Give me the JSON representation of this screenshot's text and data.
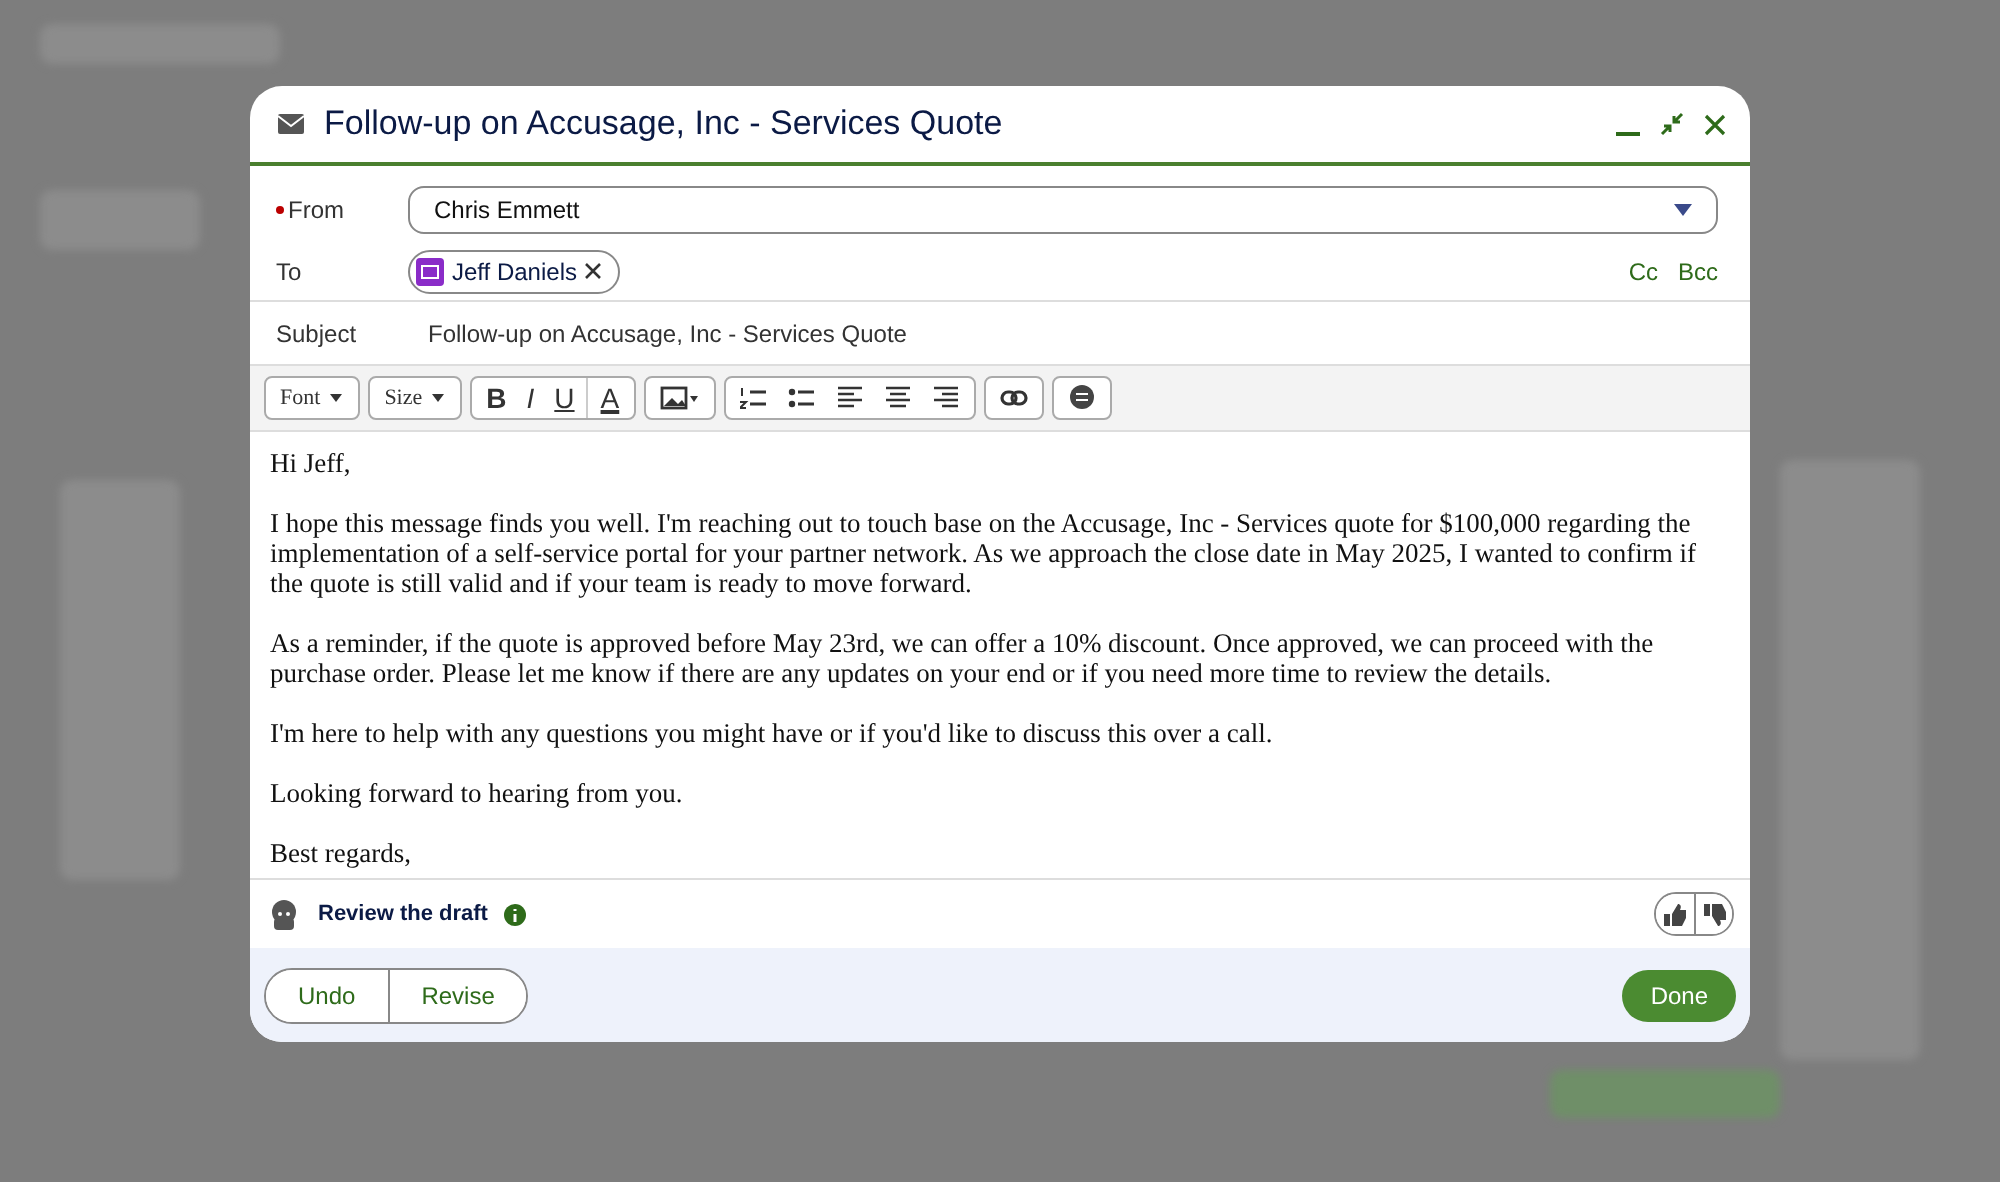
{
  "dialog": {
    "title": "Follow-up on Accusage, Inc - Services Quote"
  },
  "from": {
    "label": "From",
    "required": true,
    "value": "Chris Emmett"
  },
  "to": {
    "label": "To",
    "recipients": [
      {
        "name": "Jeff Daniels"
      }
    ],
    "cc": "Cc",
    "bcc": "Bcc"
  },
  "subject": {
    "label": "Subject",
    "value": "Follow-up on Accusage, Inc - Services Quote"
  },
  "toolbar": [
    {
      "items": [
        {
          "kind": "dropdown",
          "label": "Font"
        }
      ]
    },
    {
      "items": [
        {
          "kind": "dropdown",
          "label": "Size"
        }
      ]
    },
    {
      "items": [
        {
          "kind": "bold",
          "label": "B"
        },
        {
          "kind": "italic",
          "label": "I"
        },
        {
          "kind": "underline",
          "label": "U"
        },
        {
          "kind": "color",
          "label": "A"
        }
      ]
    },
    {
      "items": [
        {
          "kind": "image"
        }
      ]
    },
    {
      "items": [
        {
          "kind": "numbered"
        },
        {
          "kind": "bulleted"
        },
        {
          "kind": "align-left"
        },
        {
          "kind": "align-center"
        },
        {
          "kind": "align-right"
        }
      ]
    },
    {
      "items": [
        {
          "kind": "link"
        }
      ]
    },
    {
      "items": [
        {
          "kind": "comment"
        }
      ]
    }
  ],
  "body": [
    "Hi Jeff,",
    "I hope this message finds you well. I'm reaching out to touch base on the Accusage, Inc - Services quote for $100,000 regarding the implementation of a self-service portal for your partner network. As we approach the close date in May 2025, I wanted to confirm if the quote is still valid and if your team is ready to move forward.",
    "As a reminder, if the quote is approved before May 23rd, we can offer a 10% discount. Once approved, we can proceed with the purchase order. Please let me know if there are any updates on your end or if you need more time to review the details.",
    "I'm here to help with any questions you might have or if you'd like to discuss this over a call.",
    "Looking forward to hearing from you.",
    "Best regards,"
  ],
  "review": {
    "label": "Review the draft"
  },
  "footer": {
    "undo": "Undo",
    "revise": "Revise",
    "done": "Done"
  }
}
